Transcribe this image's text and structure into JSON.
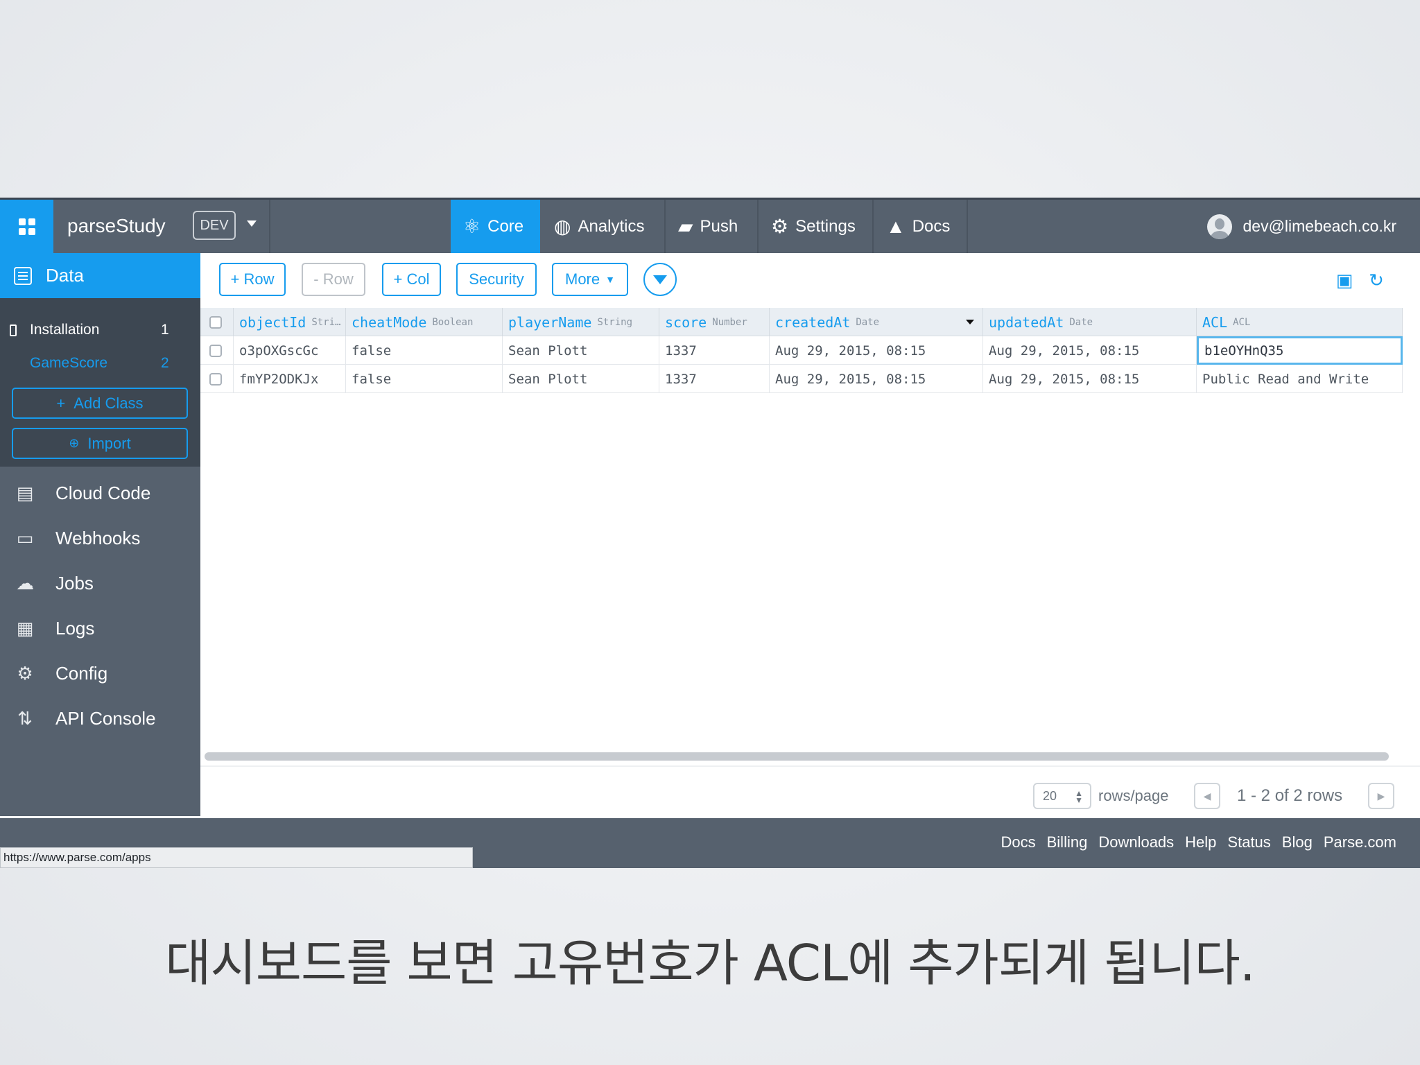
{
  "topbar": {
    "app_name": "parseStudy",
    "env": "DEV",
    "nav": [
      {
        "label": "Core",
        "icon": "atom-icon",
        "active": true
      },
      {
        "label": "Analytics",
        "icon": "pulse-icon",
        "active": false
      },
      {
        "label": "Push",
        "icon": "chat-icon",
        "active": false
      },
      {
        "label": "Settings",
        "icon": "gear-icon",
        "active": false
      },
      {
        "label": "Docs",
        "icon": "graduation-cap-icon",
        "active": false
      }
    ],
    "user_email": "dev@limebeach.co.kr"
  },
  "sidebar": {
    "section_title": "Data",
    "classes": [
      {
        "name": "Installation",
        "count": "1"
      },
      {
        "name": "GameScore",
        "count": "2"
      }
    ],
    "add_class": "Add Class",
    "import": "Import",
    "nav": [
      {
        "label": "Cloud Code",
        "icon": "document-icon"
      },
      {
        "label": "Webhooks",
        "icon": "webhook-icon"
      },
      {
        "label": "Jobs",
        "icon": "cloud-icon"
      },
      {
        "label": "Logs",
        "icon": "cabinet-icon"
      },
      {
        "label": "Config",
        "icon": "gears-icon"
      },
      {
        "label": "API Console",
        "icon": "arrows-icon"
      }
    ]
  },
  "toolbar": {
    "add_row": "+ Row",
    "remove_row": "- Row",
    "add_col": "+ Col",
    "security": "Security",
    "more": "More"
  },
  "table": {
    "columns": [
      {
        "name": "objectId",
        "type": "Stri…"
      },
      {
        "name": "cheatMode",
        "type": "Boolean"
      },
      {
        "name": "playerName",
        "type": "String"
      },
      {
        "name": "score",
        "type": "Number"
      },
      {
        "name": "createdAt",
        "type": "Date"
      },
      {
        "name": "updatedAt",
        "type": "Date"
      },
      {
        "name": "ACL",
        "type": "ACL"
      }
    ],
    "rows": [
      [
        "o3pOXGscGc",
        "false",
        "Sean Plott",
        "1337",
        "Aug 29, 2015, 08:15",
        "Aug 29, 2015, 08:15",
        "b1eOYHnQ35"
      ],
      [
        "fmYP2ODKJx",
        "false",
        "Sean Plott",
        "1337",
        "Aug 29, 2015, 08:15",
        "Aug 29, 2015, 08:15",
        "Public Read and Write"
      ]
    ]
  },
  "pagination": {
    "page_size": "20",
    "rows_label": "rows/page",
    "range": "1 - 2 of 2 rows"
  },
  "footer": {
    "links": [
      "Docs",
      "Billing",
      "Downloads",
      "Help",
      "Status",
      "Blog",
      "Parse.com"
    ],
    "status_url": "https://www.parse.com/apps"
  },
  "caption": "대시보드를 보면 고유번호가 ACL에 추가되게 됩니다.",
  "colors": {
    "accent": "#169cee",
    "chrome": "#56616e",
    "sidebar_dark": "#3d4752"
  }
}
